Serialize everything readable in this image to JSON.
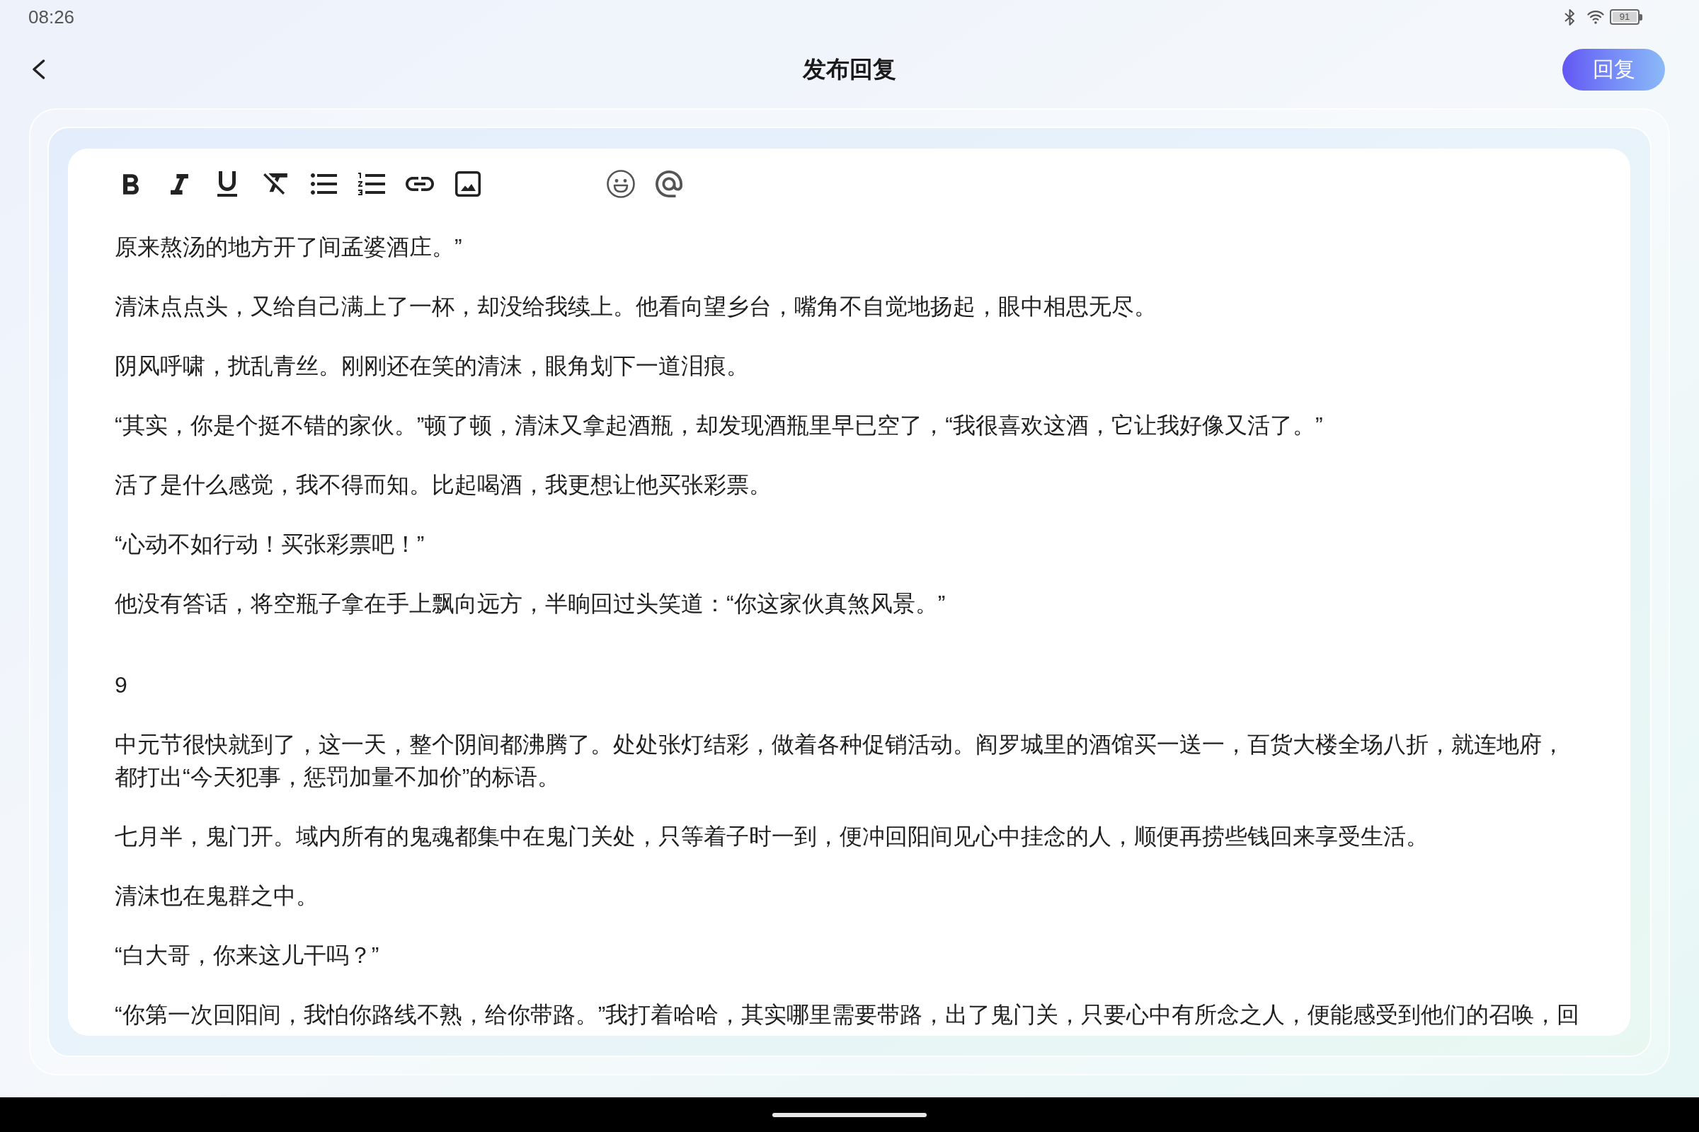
{
  "status_bar": {
    "time": "08:26",
    "battery": "91"
  },
  "header": {
    "title": "发布回复",
    "action_button": "回复"
  },
  "editor": {
    "paragraphs": [
      {
        "kind": "paragraph",
        "text": "原来熬汤的地方开了间孟婆酒庄。”"
      },
      {
        "kind": "paragraph",
        "text": "清沫点点头，又给自己满上了一杯，却没给我续上。他看向望乡台，嘴角不自觉地扬起，眼中相思无尽。"
      },
      {
        "kind": "paragraph",
        "text": "阴风呼啸，扰乱青丝。刚刚还在笑的清沫，眼角划下一道泪痕。"
      },
      {
        "kind": "paragraph",
        "text": "“其实，你是个挺不错的家伙。”顿了顿，清沫又拿起酒瓶，却发现酒瓶里早已空了，“我很喜欢这酒，它让我好像又活了。”"
      },
      {
        "kind": "paragraph",
        "text": "活了是什么感觉，我不得而知。比起喝酒，我更想让他买张彩票。"
      },
      {
        "kind": "paragraph",
        "text": "“心动不如行动！买张彩票吧！”"
      },
      {
        "kind": "paragraph",
        "text": "他没有答话，将空瓶子拿在手上飘向远方，半晌回过头笑道：“你这家伙真煞风景。”"
      },
      {
        "kind": "heading",
        "text": "9"
      },
      {
        "kind": "paragraph",
        "text": "中元节很快就到了，这一天，整个阴间都沸腾了。处处张灯结彩，做着各种促销活动。阎罗城里的酒馆买一送一，百货大楼全场八折，就连地府，都打出“今天犯事，惩罚加量不加价”的标语。"
      },
      {
        "kind": "paragraph",
        "text": "七月半，鬼门开。域内所有的鬼魂都集中在鬼门关处，只等着子时一到，便冲回阳间见心中挂念的人，顺便再捞些钱回来享受生活。"
      },
      {
        "kind": "paragraph",
        "text": "清沫也在鬼群之中。"
      },
      {
        "kind": "paragraph",
        "text": "“白大哥，你来这儿干吗？”"
      },
      {
        "kind": "paragraph",
        "text": "“你第一次回阳间，我怕你路线不熟，给你带路。”我打着哈哈，其实哪里需要带路，出了鬼门关，只要心中有所念之人，便能感受到他们的召唤，回"
      }
    ]
  }
}
